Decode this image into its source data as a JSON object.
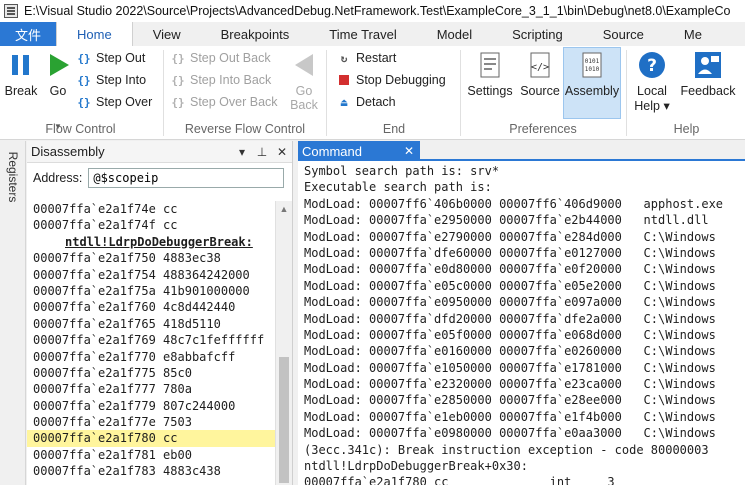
{
  "window": {
    "title": "E:\\Visual Studio 2022\\Source\\Projects\\AdvancedDebug.NetFramework.Test\\ExampleCore_3_1_1\\bin\\Debug\\net8.0\\ExampleCo"
  },
  "ribbon": {
    "tabs": [
      "文件",
      "Home",
      "View",
      "Breakpoints",
      "Time Travel",
      "Model",
      "Scripting",
      "Source",
      "Me"
    ],
    "active_tab": "Home",
    "flow_control": {
      "label": "Flow Control",
      "break": "Break",
      "go": "Go",
      "step_out": "Step Out",
      "step_into": "Step Into",
      "step_over": "Step Over"
    },
    "reverse_flow": {
      "label": "Reverse Flow Control",
      "step_out_back": "Step Out Back",
      "step_into_back": "Step Into Back",
      "step_over_back": "Step Over Back",
      "go_back_1": "Go",
      "go_back_2": "Back"
    },
    "end": {
      "label": "End",
      "restart": "Restart",
      "stop": "Stop Debugging",
      "detach": "Detach"
    },
    "preferences": {
      "label": "Preferences",
      "settings": "Settings",
      "source": "Source",
      "assembly": "Assembly"
    },
    "help": {
      "label": "Help",
      "local_help_1": "Local",
      "local_help_2": "Help ▾",
      "feedback": "Feedback"
    }
  },
  "side_tab": "Registers",
  "disassembly": {
    "title": "Disassembly",
    "address_label": "Address:",
    "address_value": "@$scopeip",
    "lines": [
      {
        "text": "00007ffa`e2a1f74e cc",
        "type": "code"
      },
      {
        "text": "00007ffa`e2a1f74f cc",
        "type": "code"
      },
      {
        "text": "ntdll!LdrpDoDebuggerBreak:",
        "type": "label"
      },
      {
        "text": "00007ffa`e2a1f750 4883ec38",
        "type": "code"
      },
      {
        "text": "00007ffa`e2a1f754 488364242000",
        "type": "code"
      },
      {
        "text": "00007ffa`e2a1f75a 41b901000000",
        "type": "code"
      },
      {
        "text": "00007ffa`e2a1f760 4c8d442440",
        "type": "code"
      },
      {
        "text": "00007ffa`e2a1f765 418d5110",
        "type": "code"
      },
      {
        "text": "00007ffa`e2a1f769 48c7c1feffffff",
        "type": "code"
      },
      {
        "text": "00007ffa`e2a1f770 e8abbafcff",
        "type": "code"
      },
      {
        "text": "00007ffa`e2a1f775 85c0",
        "type": "code"
      },
      {
        "text": "00007ffa`e2a1f777 780a",
        "type": "code"
      },
      {
        "text": "00007ffa`e2a1f779 807c244000",
        "type": "code"
      },
      {
        "text": "00007ffa`e2a1f77e 7503",
        "type": "code"
      },
      {
        "text": "00007ffa`e2a1f780 cc",
        "type": "current"
      },
      {
        "text": "00007ffa`e2a1f781 eb00",
        "type": "code"
      },
      {
        "text": "00007ffa`e2a1f783 4883c438",
        "type": "code"
      }
    ]
  },
  "command": {
    "tab_label": "Command",
    "close": "✕",
    "lines": [
      "Symbol search path is: srv*",
      "Executable search path is:",
      "ModLoad: 00007ff6`406b0000 00007ff6`406d9000   apphost.exe",
      "ModLoad: 00007ffa`e2950000 00007ffa`e2b44000   ntdll.dll",
      "ModLoad: 00007ffa`e2790000 00007ffa`e284d000   C:\\Windows",
      "ModLoad: 00007ffa`dfe60000 00007ffa`e0127000   C:\\Windows",
      "ModLoad: 00007ffa`e0d80000 00007ffa`e0f20000   C:\\Windows",
      "ModLoad: 00007ffa`e05c0000 00007ffa`e05e2000   C:\\Windows",
      "ModLoad: 00007ffa`e0950000 00007ffa`e097a000   C:\\Windows",
      "ModLoad: 00007ffa`dfd20000 00007ffa`dfe2a000   C:\\Windows",
      "ModLoad: 00007ffa`e05f0000 00007ffa`e068d000   C:\\Windows",
      "ModLoad: 00007ffa`e0160000 00007ffa`e0260000   C:\\Windows",
      "ModLoad: 00007ffa`e1050000 00007ffa`e1781000   C:\\Windows",
      "ModLoad: 00007ffa`e2320000 00007ffa`e23ca000   C:\\Windows",
      "ModLoad: 00007ffa`e2850000 00007ffa`e28ee000   C:\\Windows",
      "ModLoad: 00007ffa`e1eb0000 00007ffa`e1f4b000   C:\\Windows",
      "ModLoad: 00007ffa`e0980000 00007ffa`e0aa3000   C:\\Windows",
      "(3ecc.341c): Break instruction exception - code 80000003",
      "ntdll!LdrpDoDebuggerBreak+0x30:",
      "00007ffa`e2a1f780 cc              int     3"
    ]
  }
}
